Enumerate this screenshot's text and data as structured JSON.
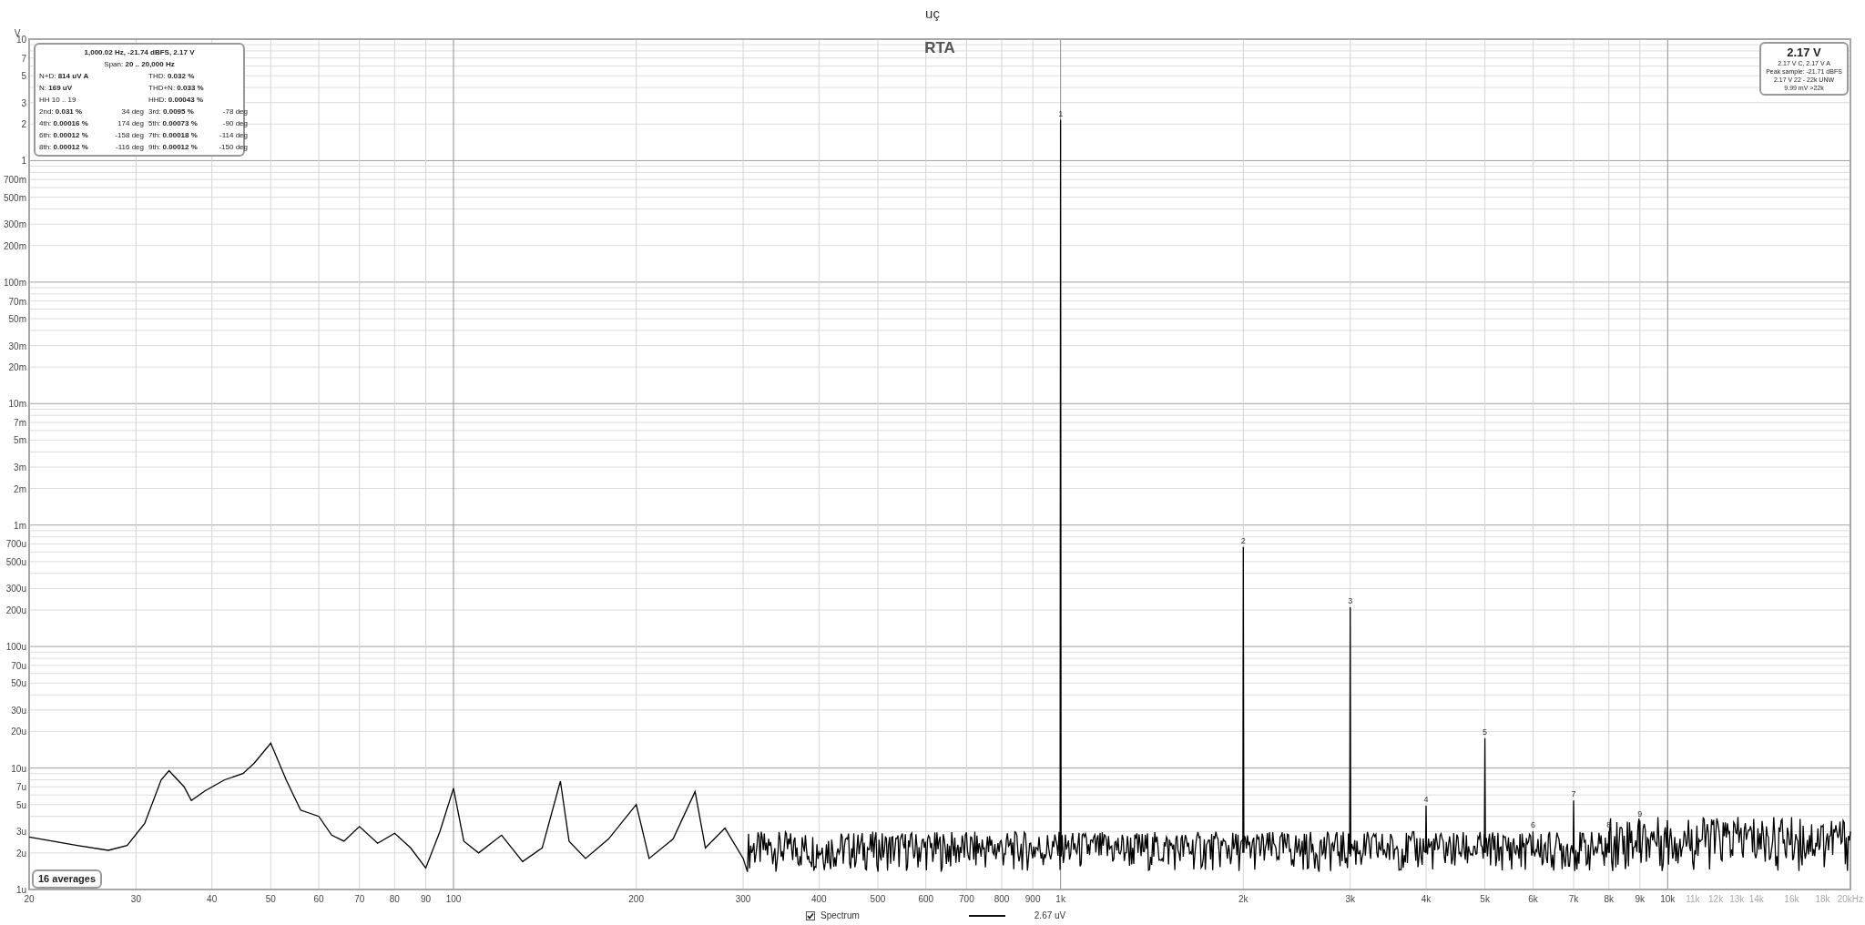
{
  "title": "uç",
  "chart": {
    "title": "RTA",
    "y_unit": "V",
    "y_axis_labels": [
      "10",
      "7",
      "5",
      "3",
      "2",
      "1",
      "700m",
      "500m",
      "300m",
      "200m",
      "100m",
      "70m",
      "50m",
      "30m",
      "20m",
      "10m",
      "7m",
      "5m",
      "3m",
      "2m",
      "1m",
      "700u",
      "500u",
      "300u",
      "200u",
      "100u",
      "70u",
      "50u",
      "30u",
      "20u",
      "10u",
      "7u",
      "5u",
      "3u",
      "2u",
      "1u"
    ],
    "x_axis_labels": [
      "20",
      "30",
      "40",
      "50",
      "60",
      "70",
      "80",
      "90",
      "100",
      "200",
      "300",
      "400",
      "500",
      "600",
      "700",
      "800",
      "900",
      "1k",
      "2k",
      "3k",
      "4k",
      "5k",
      "6k",
      "7k",
      "8k",
      "9k",
      "10k",
      "11k",
      "12k",
      "13k",
      "14k",
      "16k",
      "18k",
      "20kHz"
    ],
    "harmonic_labels": [
      "1",
      "2",
      "3",
      "4",
      "5",
      "6",
      "7",
      "8",
      "9"
    ],
    "info_box": {
      "lines": [
        "1,000.02 Hz, -21.74 dBFS, 2.17 V",
        "Span: **20 .. 20,000 Hz**"
      ],
      "rows": [
        {
          "left": "N+D: **814 uV A**",
          "right": "THD: **0.032 %**"
        },
        {
          "left": "N: **169 uV**",
          "right": "THD+N: **0.033 %**"
        },
        {
          "left": "HH 10 .. 19",
          "right": "HHD: **0.00043 %**"
        },
        {
          "left": "2nd: **0.031 %**",
          "left_phase": "34 deg",
          "right": "3rd: **0.0095 %**",
          "right_phase": "-78 deg"
        },
        {
          "left": "4th: **0.00016 %**",
          "left_phase": "174 deg",
          "right": "5th: **0.00073 %**",
          "right_phase": "-90 deg"
        },
        {
          "left": "6th: **0.00012 %**",
          "left_phase": "-158 deg",
          "right": "7th: **0.00018 %**",
          "right_phase": "-114 deg"
        },
        {
          "left": "8th: **0.00012 %**",
          "left_phase": "-116 deg",
          "right": "9th: **0.00012 %**",
          "right_phase": "-150 deg"
        }
      ]
    },
    "level_box": {
      "value": "2.17 V",
      "lines": [
        "2.17 V C, 2.17 V A",
        "Peak sample: -21.71 dBFS",
        "2.17 V 22 - 22k UNW",
        "9.99 mV >22k"
      ]
    },
    "averages": "16 averages"
  },
  "legend": [
    {
      "kind": "checkbox",
      "label": "Spectrum",
      "checked": true
    },
    {
      "kind": "line",
      "label": "2.67 uV"
    }
  ]
}
